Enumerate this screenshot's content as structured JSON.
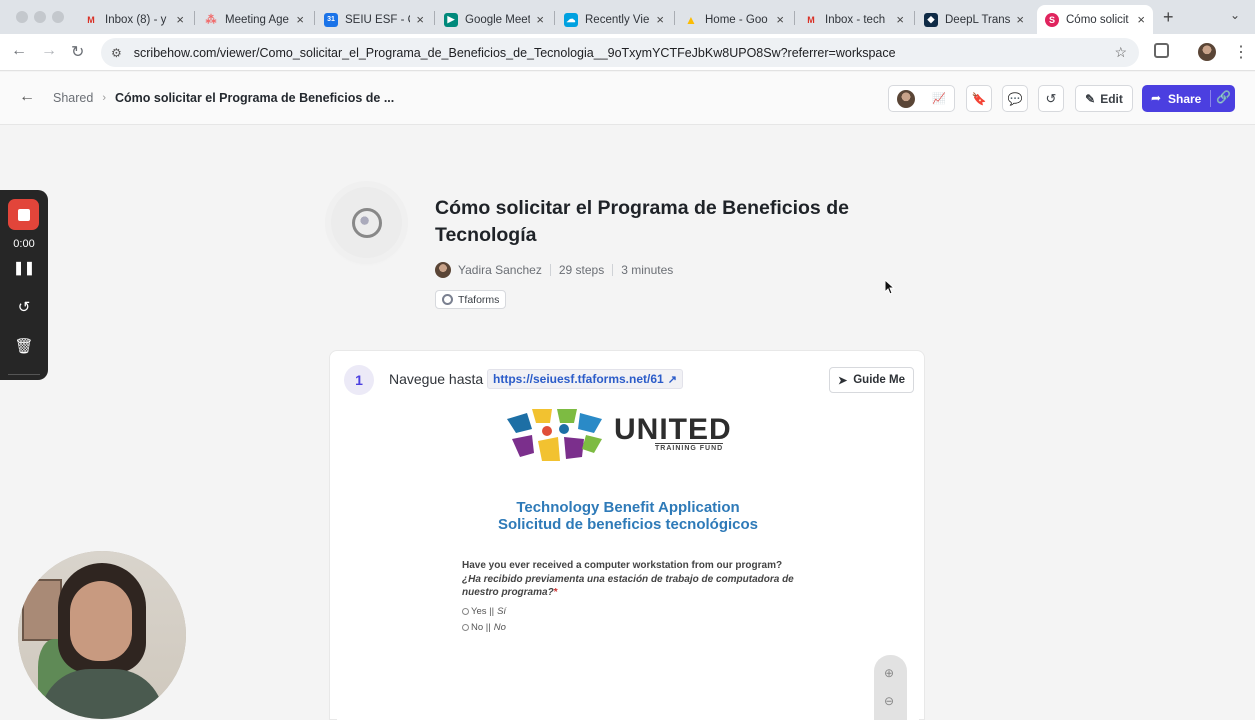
{
  "browser": {
    "tabs": [
      {
        "label": "Inbox (8) - y",
        "icon": "gmail-icon",
        "color": "#d93025",
        "glyph": "M"
      },
      {
        "label": "Meeting Age",
        "icon": "asana-icon",
        "color": "#f06a6a",
        "glyph": "●"
      },
      {
        "label": "SEIU ESF - C",
        "icon": "calendar-icon",
        "color": "#1a73e8",
        "glyph": "31"
      },
      {
        "label": "Google Meet",
        "icon": "meet-icon",
        "color": "#00897b",
        "glyph": "▶"
      },
      {
        "label": "Recently Vie",
        "icon": "salesforce-icon",
        "color": "#00a1e0",
        "glyph": "☁"
      },
      {
        "label": "Home - Goo",
        "icon": "drive-icon",
        "color": "#fbbc04",
        "glyph": "▲"
      },
      {
        "label": "Inbox - tech",
        "icon": "gmail-icon",
        "color": "#d93025",
        "glyph": "M"
      },
      {
        "label": "DeepL Transl",
        "icon": "deepl-icon",
        "color": "#0f2b46",
        "glyph": "◆"
      },
      {
        "label": "Cómo solicit",
        "icon": "scribe-icon",
        "color": "#e0245e",
        "glyph": "S"
      }
    ],
    "url": "scribehow.com/viewer/Como_solicitar_el_Programa_de_Beneficios_de_Tecnologia__9oTxymYCTFeJbKw8UPO8Sw?referrer=workspace"
  },
  "header": {
    "breadcrumb_root": "Shared",
    "breadcrumb_current": "Cómo solicitar el Programa de Beneficios de ...",
    "edit_label": "Edit",
    "share_label": "Share"
  },
  "doc": {
    "title": "Cómo solicitar el Programa de Beneficios de Tecnología",
    "author": "Yadira Sanchez",
    "steps_count": "29 steps",
    "duration": "3 minutes",
    "tag": "Tfaforms"
  },
  "step1": {
    "number": "1",
    "text": "Navegue hasta",
    "link": "https://seiuesf.tfaforms.net/61",
    "guide_label": "Guide Me",
    "screenshot": {
      "logo_text": "UNITED",
      "logo_sub": "TRAINING FUND",
      "title_en": "Technology Benefit Application",
      "title_es": "Solicitud de beneficios tecnológicos",
      "question_en": "Have you ever received a computer workstation from our program?",
      "question_es": "¿Ha recibido previamenta una estación de trabajo de computadora de nuestro programa?",
      "required_mark": "*",
      "options": [
        {
          "en": "Yes ||",
          "es": "Sí"
        },
        {
          "en": "No ||",
          "es": "No"
        }
      ]
    }
  },
  "recorder": {
    "time": "0:00"
  }
}
